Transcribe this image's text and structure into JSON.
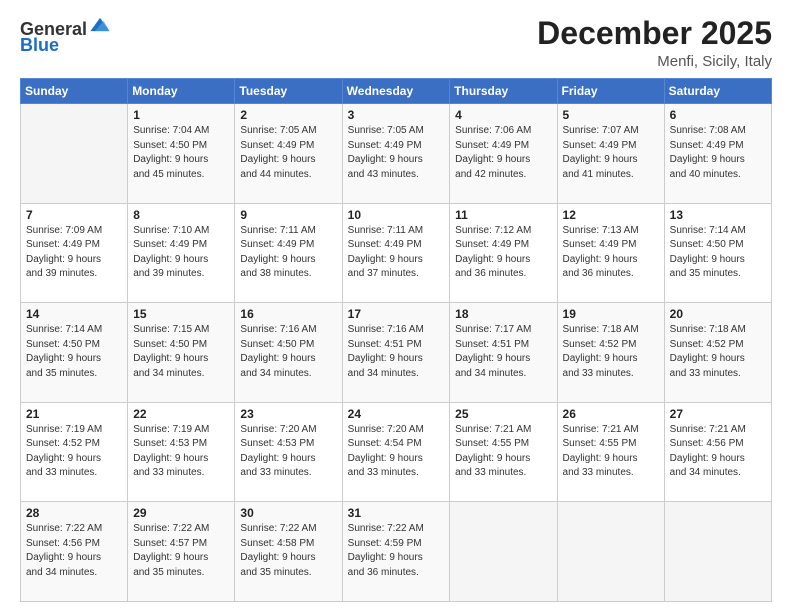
{
  "logo": {
    "general": "General",
    "blue": "Blue"
  },
  "title": "December 2025",
  "subtitle": "Menfi, Sicily, Italy",
  "weekdays": [
    "Sunday",
    "Monday",
    "Tuesday",
    "Wednesday",
    "Thursday",
    "Friday",
    "Saturday"
  ],
  "weeks": [
    [
      {
        "day": "",
        "info": ""
      },
      {
        "day": "1",
        "info": "Sunrise: 7:04 AM\nSunset: 4:50 PM\nDaylight: 9 hours\nand 45 minutes."
      },
      {
        "day": "2",
        "info": "Sunrise: 7:05 AM\nSunset: 4:49 PM\nDaylight: 9 hours\nand 44 minutes."
      },
      {
        "day": "3",
        "info": "Sunrise: 7:05 AM\nSunset: 4:49 PM\nDaylight: 9 hours\nand 43 minutes."
      },
      {
        "day": "4",
        "info": "Sunrise: 7:06 AM\nSunset: 4:49 PM\nDaylight: 9 hours\nand 42 minutes."
      },
      {
        "day": "5",
        "info": "Sunrise: 7:07 AM\nSunset: 4:49 PM\nDaylight: 9 hours\nand 41 minutes."
      },
      {
        "day": "6",
        "info": "Sunrise: 7:08 AM\nSunset: 4:49 PM\nDaylight: 9 hours\nand 40 minutes."
      }
    ],
    [
      {
        "day": "7",
        "info": "Sunrise: 7:09 AM\nSunset: 4:49 PM\nDaylight: 9 hours\nand 39 minutes."
      },
      {
        "day": "8",
        "info": "Sunrise: 7:10 AM\nSunset: 4:49 PM\nDaylight: 9 hours\nand 39 minutes."
      },
      {
        "day": "9",
        "info": "Sunrise: 7:11 AM\nSunset: 4:49 PM\nDaylight: 9 hours\nand 38 minutes."
      },
      {
        "day": "10",
        "info": "Sunrise: 7:11 AM\nSunset: 4:49 PM\nDaylight: 9 hours\nand 37 minutes."
      },
      {
        "day": "11",
        "info": "Sunrise: 7:12 AM\nSunset: 4:49 PM\nDaylight: 9 hours\nand 36 minutes."
      },
      {
        "day": "12",
        "info": "Sunrise: 7:13 AM\nSunset: 4:49 PM\nDaylight: 9 hours\nand 36 minutes."
      },
      {
        "day": "13",
        "info": "Sunrise: 7:14 AM\nSunset: 4:50 PM\nDaylight: 9 hours\nand 35 minutes."
      }
    ],
    [
      {
        "day": "14",
        "info": "Sunrise: 7:14 AM\nSunset: 4:50 PM\nDaylight: 9 hours\nand 35 minutes."
      },
      {
        "day": "15",
        "info": "Sunrise: 7:15 AM\nSunset: 4:50 PM\nDaylight: 9 hours\nand 34 minutes."
      },
      {
        "day": "16",
        "info": "Sunrise: 7:16 AM\nSunset: 4:50 PM\nDaylight: 9 hours\nand 34 minutes."
      },
      {
        "day": "17",
        "info": "Sunrise: 7:16 AM\nSunset: 4:51 PM\nDaylight: 9 hours\nand 34 minutes."
      },
      {
        "day": "18",
        "info": "Sunrise: 7:17 AM\nSunset: 4:51 PM\nDaylight: 9 hours\nand 34 minutes."
      },
      {
        "day": "19",
        "info": "Sunrise: 7:18 AM\nSunset: 4:52 PM\nDaylight: 9 hours\nand 33 minutes."
      },
      {
        "day": "20",
        "info": "Sunrise: 7:18 AM\nSunset: 4:52 PM\nDaylight: 9 hours\nand 33 minutes."
      }
    ],
    [
      {
        "day": "21",
        "info": "Sunrise: 7:19 AM\nSunset: 4:52 PM\nDaylight: 9 hours\nand 33 minutes."
      },
      {
        "day": "22",
        "info": "Sunrise: 7:19 AM\nSunset: 4:53 PM\nDaylight: 9 hours\nand 33 minutes."
      },
      {
        "day": "23",
        "info": "Sunrise: 7:20 AM\nSunset: 4:53 PM\nDaylight: 9 hours\nand 33 minutes."
      },
      {
        "day": "24",
        "info": "Sunrise: 7:20 AM\nSunset: 4:54 PM\nDaylight: 9 hours\nand 33 minutes."
      },
      {
        "day": "25",
        "info": "Sunrise: 7:21 AM\nSunset: 4:55 PM\nDaylight: 9 hours\nand 33 minutes."
      },
      {
        "day": "26",
        "info": "Sunrise: 7:21 AM\nSunset: 4:55 PM\nDaylight: 9 hours\nand 33 minutes."
      },
      {
        "day": "27",
        "info": "Sunrise: 7:21 AM\nSunset: 4:56 PM\nDaylight: 9 hours\nand 34 minutes."
      }
    ],
    [
      {
        "day": "28",
        "info": "Sunrise: 7:22 AM\nSunset: 4:56 PM\nDaylight: 9 hours\nand 34 minutes."
      },
      {
        "day": "29",
        "info": "Sunrise: 7:22 AM\nSunset: 4:57 PM\nDaylight: 9 hours\nand 35 minutes."
      },
      {
        "day": "30",
        "info": "Sunrise: 7:22 AM\nSunset: 4:58 PM\nDaylight: 9 hours\nand 35 minutes."
      },
      {
        "day": "31",
        "info": "Sunrise: 7:22 AM\nSunset: 4:59 PM\nDaylight: 9 hours\nand 36 minutes."
      },
      {
        "day": "",
        "info": ""
      },
      {
        "day": "",
        "info": ""
      },
      {
        "day": "",
        "info": ""
      }
    ]
  ]
}
